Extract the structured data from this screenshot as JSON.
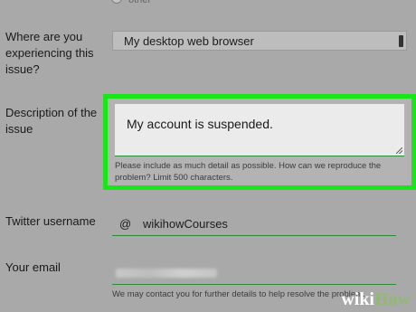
{
  "top_radio": {
    "label": "other"
  },
  "issue_location": {
    "label": "Where are you experiencing this issue?",
    "selected": "My desktop web browser"
  },
  "description": {
    "label": "Description of the issue",
    "value": "My account is suspended.",
    "help": "Please include as much detail as possible. How can we reproduce the problem? Limit 500 characters."
  },
  "twitter": {
    "label": "Twitter username",
    "prefix": "@",
    "value": "wikihowCourses"
  },
  "email": {
    "label": "Your email",
    "help": "We may contact you for further details to help resolve the problem."
  },
  "watermark": {
    "wiki": "wiki",
    "how": "How"
  },
  "colors": {
    "highlight": "#19e619",
    "underline": "#2e8b3e",
    "background": "#a9a9a9"
  }
}
